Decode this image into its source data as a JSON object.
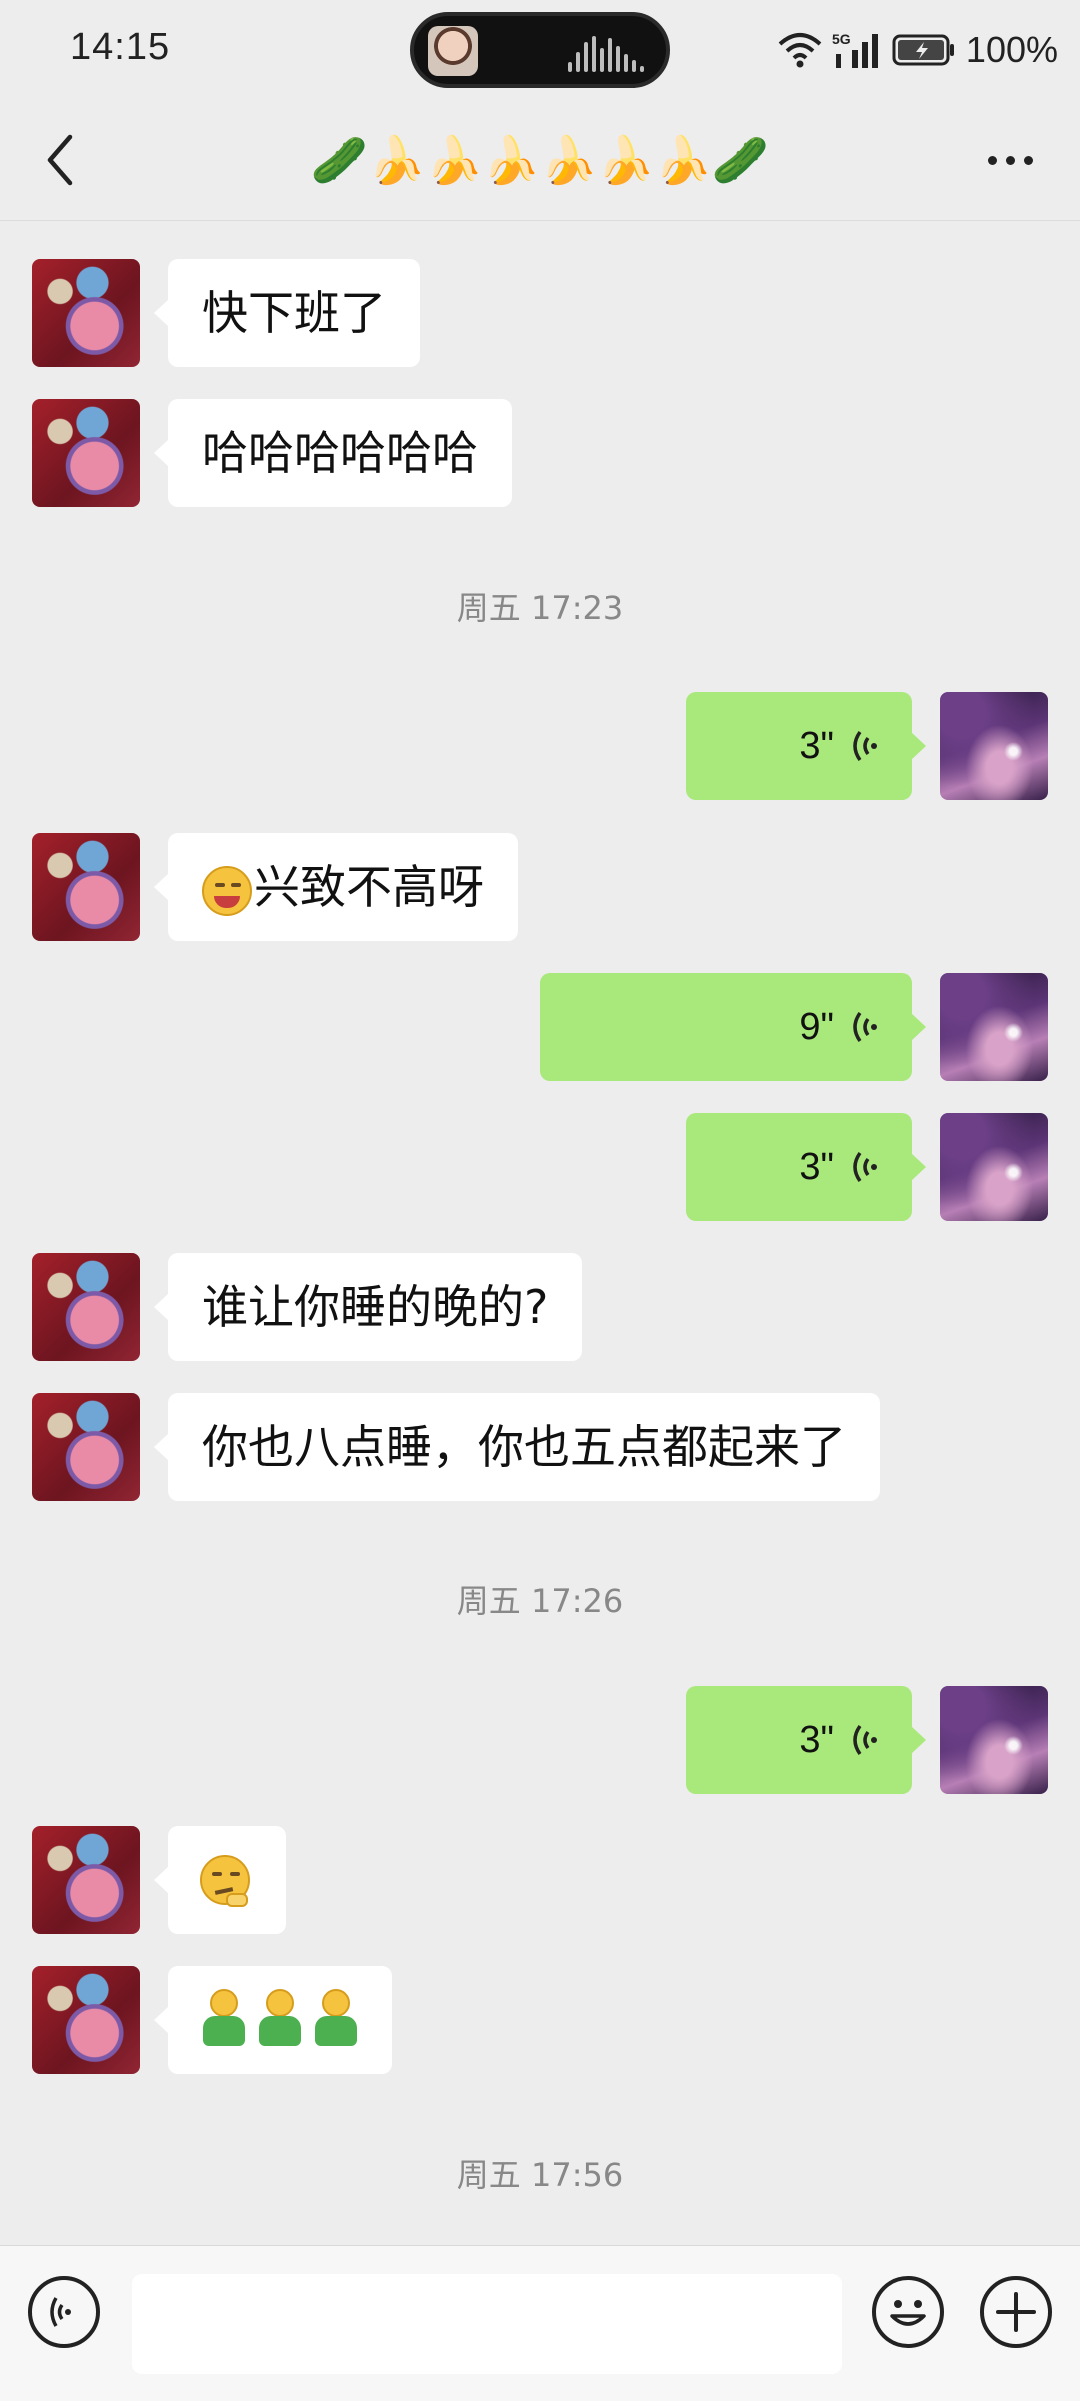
{
  "status_bar": {
    "time": "14:15",
    "network": "5G",
    "battery": "100%"
  },
  "header": {
    "title": "🥒🍌🍌🍌🍌🍌🍌🥒"
  },
  "messages": [
    {
      "side": "left",
      "type": "text",
      "text": "快下班了"
    },
    {
      "side": "left",
      "type": "text",
      "text": "哈哈哈哈哈哈"
    },
    {
      "side": "center",
      "type": "time",
      "text": "周五 17:23"
    },
    {
      "side": "right",
      "type": "voice",
      "duration": "3\""
    },
    {
      "side": "left",
      "type": "text",
      "emoji": "shy-face",
      "text": "兴致不高呀"
    },
    {
      "side": "right",
      "type": "voice",
      "duration": "9\""
    },
    {
      "side": "right",
      "type": "voice",
      "duration": "3\""
    },
    {
      "side": "left",
      "type": "text",
      "text": "谁让你睡的晚的?"
    },
    {
      "side": "left",
      "type": "text",
      "text": "你也八点睡，你也五点都起来了"
    },
    {
      "side": "center",
      "type": "time",
      "text": "周五 17:26"
    },
    {
      "side": "right",
      "type": "voice",
      "duration": "3\""
    },
    {
      "side": "left",
      "type": "emoji",
      "emoji": "thinking-face"
    },
    {
      "side": "left",
      "type": "emoji",
      "emoji": "green-figure",
      "count": 3
    },
    {
      "side": "center",
      "type": "time",
      "text": "周五 17:56"
    }
  ],
  "input": {
    "placeholder": ""
  },
  "colors": {
    "background": "#ededed",
    "my_bubble": "#a9e97b",
    "friend_bubble": "#ffffff",
    "timestamp_text": "#888888"
  }
}
